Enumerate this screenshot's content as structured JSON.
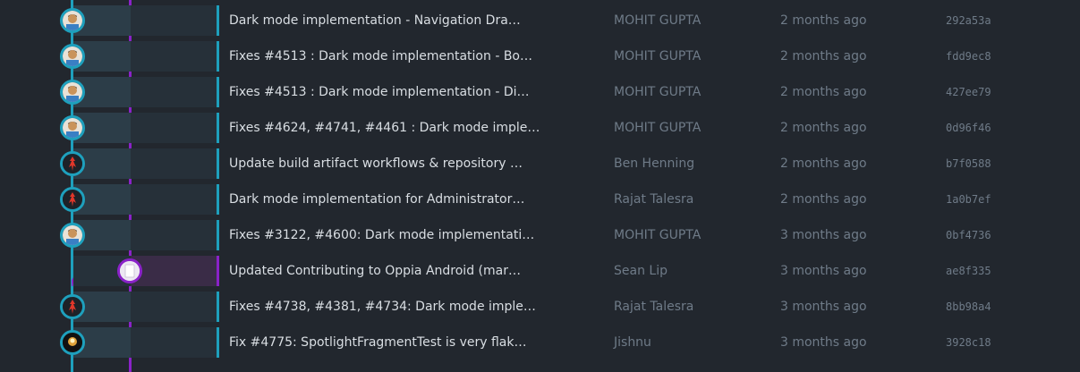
{
  "colors": {
    "background": "#22272e",
    "branch_main": "#1ea0bd",
    "branch_side": "#8a22c8",
    "subject_text": "#d9dee3",
    "meta_text": "#6f7b88"
  },
  "commits": [
    {
      "subject": "Dark mode implementation - Navigation Dra…",
      "author": "MOHIT GUPTA",
      "date": "2 months ago",
      "sha": "292a53a",
      "avatar": "avatar-person-icon",
      "branch": "main"
    },
    {
      "subject": "Fixes #4513 : Dark mode implementation - Bo…",
      "author": "MOHIT GUPTA",
      "date": "2 months ago",
      "sha": "fdd9ec8",
      "avatar": "avatar-person-icon",
      "branch": "main"
    },
    {
      "subject": "Fixes #4513 : Dark mode implementation - Di…",
      "author": "MOHIT GUPTA",
      "date": "2 months ago",
      "sha": "427ee79",
      "avatar": "avatar-person-icon",
      "branch": "main"
    },
    {
      "subject": "Fixes #4624, #4741, #4461 : Dark mode imple…",
      "author": "MOHIT GUPTA",
      "date": "2 months ago",
      "sha": "0d96f46",
      "avatar": "avatar-person-icon",
      "branch": "main"
    },
    {
      "subject": "Update build artifact workflows & repository …",
      "author": "Ben Henning",
      "date": "2 months ago",
      "sha": "b7f0588",
      "avatar": "avatar-red-figure-icon",
      "branch": "main"
    },
    {
      "subject": "Dark mode implementation for Administrator…",
      "author": "Rajat Talesra",
      "date": "2 months ago",
      "sha": "1a0b7ef",
      "avatar": "avatar-red-figure-icon",
      "branch": "main"
    },
    {
      "subject": "Fixes #3122, #4600: Dark mode implementati…",
      "author": "MOHIT GUPTA",
      "date": "3 months ago",
      "sha": "0bf4736",
      "avatar": "avatar-person-icon",
      "branch": "main"
    },
    {
      "subject": "Updated Contributing to Oppia Android (mar…",
      "author": "Sean Lip",
      "date": "3 months ago",
      "sha": "ae8f335",
      "avatar": "avatar-white-block-icon",
      "branch": "side"
    },
    {
      "subject": "Fixes #4738, #4381, #4734: Dark mode imple…",
      "author": "Rajat Talesra",
      "date": "3 months ago",
      "sha": "8bb98a4",
      "avatar": "avatar-red-figure-icon",
      "branch": "main"
    },
    {
      "subject": "Fix #4775: SpotlightFragmentTest is very flak…",
      "author": "Jishnu",
      "date": "3 months ago",
      "sha": "3928c18",
      "avatar": "avatar-dark-icon",
      "branch": "main"
    }
  ]
}
